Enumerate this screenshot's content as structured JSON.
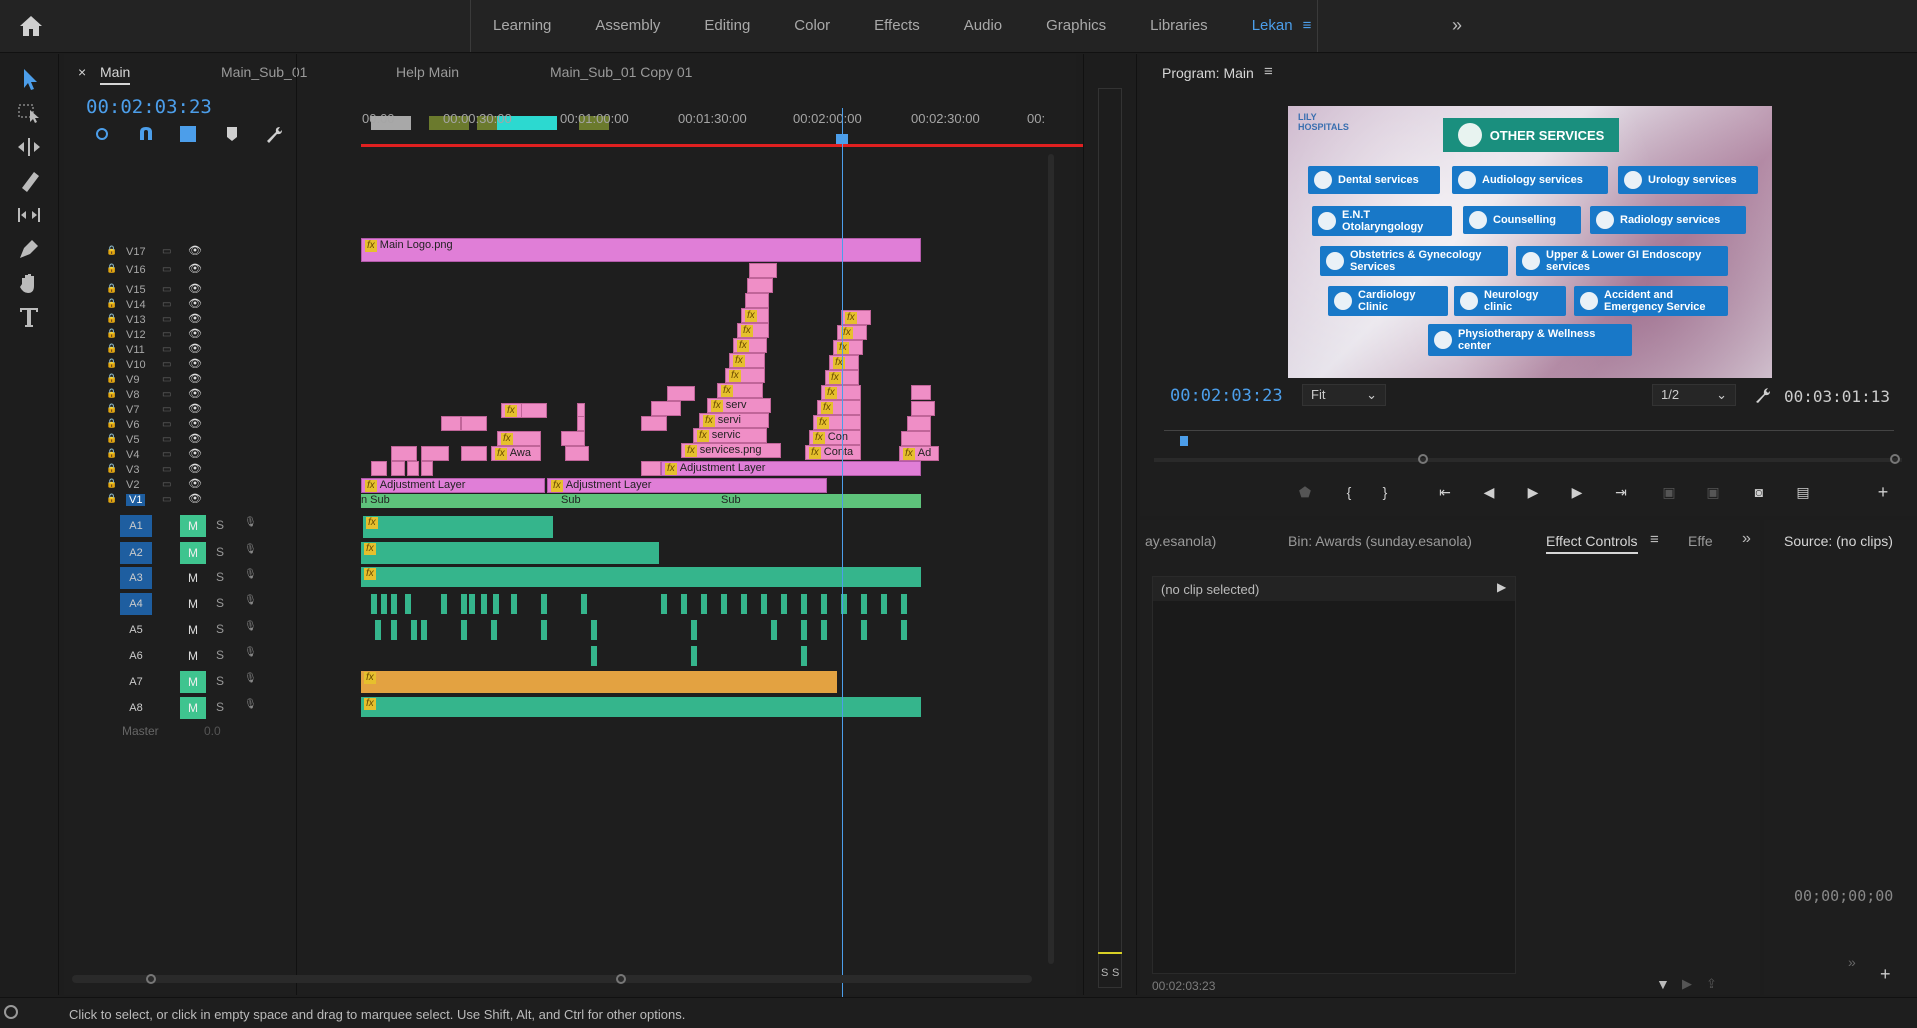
{
  "workspaces": [
    "Learning",
    "Assembly",
    "Editing",
    "Color",
    "Effects",
    "Audio",
    "Graphics",
    "Libraries",
    "Lekan"
  ],
  "active_workspace": "Lekan",
  "timeline": {
    "tabs": [
      {
        "label": "Main",
        "close": "×"
      },
      {
        "label": "Main_Sub_01"
      },
      {
        "label": "Help Main"
      },
      {
        "label": "Main_Sub_01 Copy 01"
      }
    ],
    "timecode": "00:02:03:23",
    "ruler": [
      "00:00",
      "00:00:30:00",
      "00:01:00:00",
      "00:01:30:00",
      "00:02:00:00",
      "00:02:30:00",
      "00:"
    ],
    "video_tracks": [
      "V17",
      "V16",
      "V15",
      "V14",
      "V13",
      "V12",
      "V11",
      "V10",
      "V9",
      "V8",
      "V7",
      "V6",
      "V5",
      "V4",
      "V3",
      "V2",
      "V1"
    ],
    "audio_tracks": [
      "A1",
      "A2",
      "A3",
      "A4",
      "A5",
      "A6",
      "A7",
      "A8"
    ],
    "master_label": "Master",
    "master_value": "0.0",
    "clips": {
      "main_logo": "Main Logo.png",
      "adjustment": "Adjustment Layer",
      "awa": "Awa",
      "services_png": "services.png",
      "servi": "servi",
      "servic": "servic",
      "serv": "serv",
      "con": "Con",
      "conta": "Conta",
      "ad": "Ad",
      "sub": "Sub",
      "n_sub": "n Sub"
    },
    "m_label": "M",
    "s_label": "S"
  },
  "program": {
    "title": "Program: Main",
    "timecode": "00:02:03:23",
    "fit": "Fit",
    "resolution": "1/2",
    "duration": "00:03:01:13",
    "frame": {
      "logo": "LILY\nHOSPITALS",
      "header": "OTHER SERVICES",
      "services": [
        "Dental services",
        "Audiology services",
        "Urology services",
        "E.N.T Otolaryngology",
        "Counselling",
        "Radiology services",
        "Obstetrics & Gynecology Services",
        "Upper & Lower GI Endoscopy services",
        "Cardiology Clinic",
        "Neurology clinic",
        "Accident and Emergency Service",
        "Physiotherapy & Wellness center"
      ]
    }
  },
  "panels": {
    "bin1": "ay.esanola)",
    "bin2": "Bin: Awards (sunday.esanola)",
    "effect_controls": "Effect Controls",
    "effe": "Effe",
    "no_clip": "(no clip selected)",
    "ec_timecode": "00:02:03:23",
    "source": "Source: (no clips)",
    "source_tc": "00;00;00;00"
  },
  "meter_labels": [
    "S",
    "S"
  ],
  "status": "Click to select, or click in empty space and drag to marquee select. Use Shift, Alt, and Ctrl for other options.",
  "colors": {
    "accent": "#4c9eea",
    "pink_clip": "#e07ed7",
    "green_clip": "#5ec37b",
    "audio_clip": "#35b58c",
    "orange_clip": "#e3a241",
    "playhead": "#4c9eea",
    "button": "#1878c8"
  }
}
